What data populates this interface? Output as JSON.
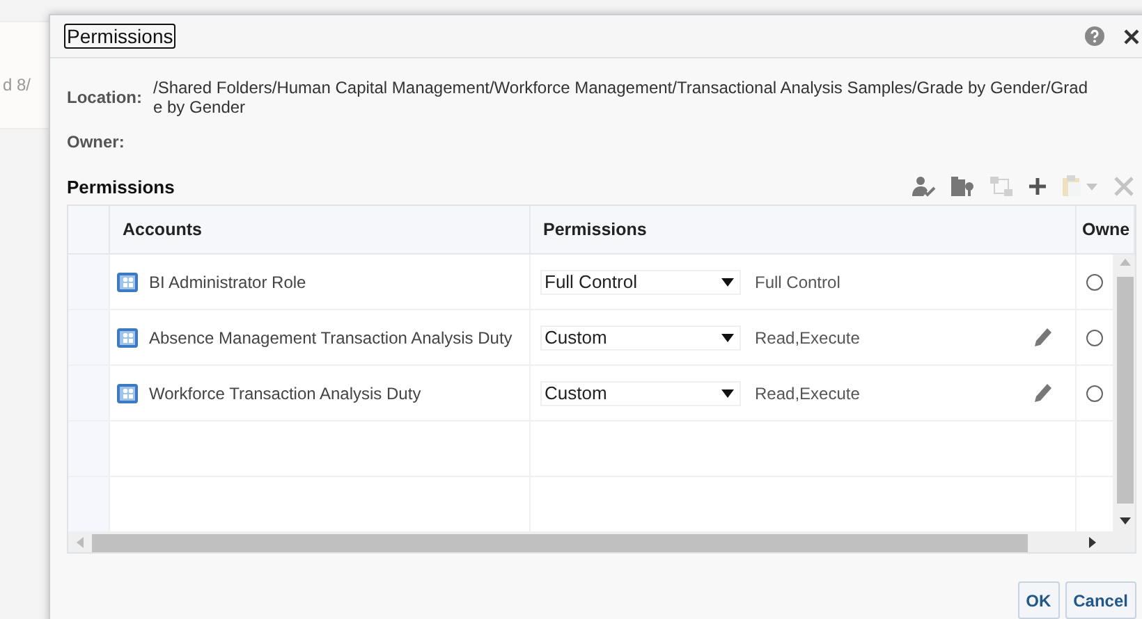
{
  "background": {
    "text": "d 8/"
  },
  "dialog": {
    "title": "Permissions",
    "location_label": "Location:",
    "location_lines": [
      "/Shared Folders/Human Capital Management/Workforce Management/Transactional Analysis Samples/Grade by Gender/Grad",
      "e by Gender"
    ],
    "owner_label": "Owner:",
    "section_title": "Permissions",
    "toolbar": [
      {
        "kind": "person",
        "disabled": false
      },
      {
        "kind": "folder",
        "disabled": false
      },
      {
        "kind": "swap",
        "disabled": true
      },
      {
        "kind": "add",
        "disabled": false
      },
      {
        "kind": "clipboard",
        "disabled": true
      },
      {
        "kind": "delete",
        "disabled": true
      }
    ],
    "table": {
      "columns": [
        "Accounts",
        "Permissions",
        "Owne"
      ],
      "rows": [
        {
          "account": "BI Administrator Role",
          "permission": "Full Control",
          "summary": "Full Control",
          "editable": false,
          "owner_selected": false
        },
        {
          "account": "Absence Management Transaction Analysis Duty",
          "permission": "Custom",
          "summary": "Read,Execute",
          "editable": true,
          "owner_selected": false
        },
        {
          "account": "Workforce Transaction Analysis Duty",
          "permission": "Custom",
          "summary": "Read,Execute",
          "editable": true,
          "owner_selected": false
        }
      ]
    },
    "buttons": [
      "OK",
      "Cancel"
    ]
  }
}
